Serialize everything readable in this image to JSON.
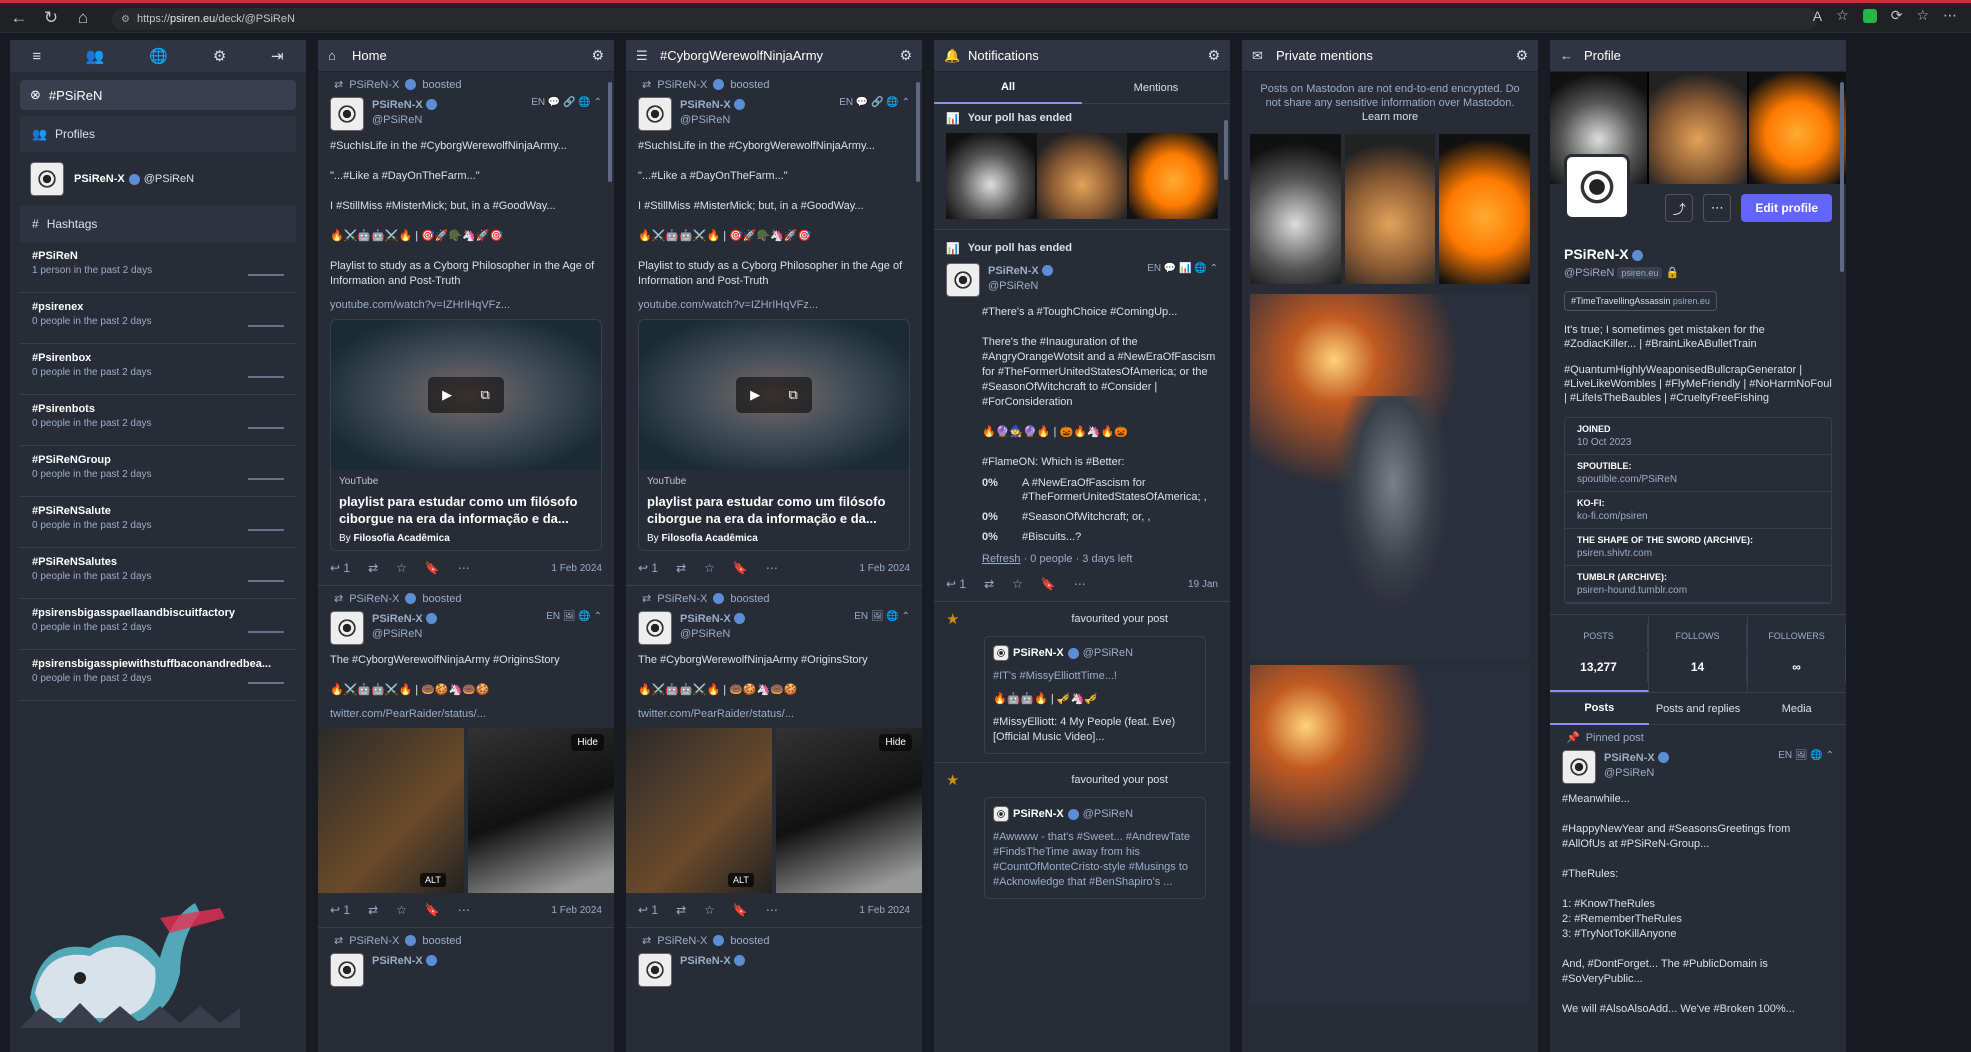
{
  "browser": {
    "url_scheme": "https://",
    "url_host": "psiren.eu",
    "url_path": "/deck/@PSiReN"
  },
  "left": {
    "active_tag": "#PSiReN",
    "profiles_label": "Profiles",
    "profile_name": "PSiReN-X",
    "profile_handle": "@PSiReN",
    "hashtags_label": "Hashtags",
    "tags": [
      {
        "name": "#PSiReN",
        "stat": "1 person in the past 2 days"
      },
      {
        "name": "#psirenex",
        "stat": "0 people in the past 2 days"
      },
      {
        "name": "#Psirenbox",
        "stat": "0 people in the past 2 days"
      },
      {
        "name": "#Psirenbots",
        "stat": "0 people in the past 2 days"
      },
      {
        "name": "#PSiReNGroup",
        "stat": "0 people in the past 2 days"
      },
      {
        "name": "#PSiReNSalute",
        "stat": "0 people in the past 2 days"
      },
      {
        "name": "#PSiReNSalutes",
        "stat": "0 people in the past 2 days"
      },
      {
        "name": "#psirensbigasspaellaandbiscuitfactory",
        "stat": "0 people in the past 2 days"
      },
      {
        "name": "#psirensbigasspiewithstuffbaconandredbea...",
        "stat": "0 people in the past 2 days"
      }
    ]
  },
  "home": {
    "title": "Home",
    "boosted_by": "PSiReN-X",
    "boosted": "boosted",
    "author": "PSiReN-X",
    "handle": "@PSiReN",
    "lang": "EN",
    "p1_l1": "#SuchIsLife in the #CyborgWerewolfNinjaArmy...",
    "p1_l2": "\"...#Like a #DayOnTheFarm...\"",
    "p1_l3": "I #StillMiss #MisterMick; but, in a #GoodWay...",
    "p1_emoji": "🔥⚔️🤖🤖⚔️🔥 | 🎯🚀🪖🦄🚀🎯",
    "p1_l4": "Playlist to study as a Cyborg Philosopher in the Age of Information and Post-Truth",
    "p1_link": "youtube.com/watch?v=IZHrIHqVFz...",
    "card_provider": "YouTube",
    "card_title": "playlist para estudar como um filósofo ciborgue na era da informação e da...",
    "card_by_prefix": "By ",
    "card_by": "Filosofia Acadêmica",
    "reply_count": "1",
    "date": "1 Feb 2024",
    "p2_l1": "The #CyborgWerewolfNinjaArmy #OriginsStory",
    "p2_emoji": "🔥⚔️🤖🤖⚔️🔥 | 🍩🍪🦄🍩🍪",
    "p2_link": "twitter.com/PearRaider/status/...",
    "hide": "Hide",
    "alt": "ALT"
  },
  "cwna": {
    "title": "#CyborgWerewolfNinjaArmy"
  },
  "notifications": {
    "title": "Notifications",
    "tab_all": "All",
    "tab_mentions": "Mentions",
    "poll_ended": "Your poll has ended",
    "p_l1": "#There's a #ToughChoice #ComingUp...",
    "p_l2": "There's the #Inauguration of the #AngryOrangeWotsit and a #NewEraOfFascism for #TheFormerUnitedStatesOfAmerica; or the #SeasonOfWitchcraft to #Consider | #ForConsideration",
    "p_emoji": "🔥🔮🧙🔮🔥 | 🎃🔥🦄🔥🎃",
    "p_l3": "#FlameON: Which is #Better:",
    "opts": [
      {
        "pct": "0%",
        "txt": "A #NewEraOfFascism for #TheFormerUnitedStatesOfAmerica; ,"
      },
      {
        "pct": "0%",
        "txt": "#SeasonOfWitchcraft; or, ,"
      },
      {
        "pct": "0%",
        "txt": "#Biscuits...?"
      }
    ],
    "refresh": "Refresh",
    "poll_meta": " · 0 people · 3 days left",
    "poll_date": "19 Jan",
    "fav": "favourited your post",
    "n1_text": "#IT's #MissyElliottTime...!",
    "n1_emoji": "🔥🤖🤖🔥 | 🎺🦄🎺",
    "n1_link": "#MissyElliott: 4 My People (feat. Eve) [Official Music Video]...",
    "n2_text": "#Awwww - that's #Sweet... #AndrewTate #FindsTheTime away from his #CountOfMonteCristo-style #Musings to #Acknowledge that #BenShapiro's ..."
  },
  "pm": {
    "title": "Private mentions",
    "note": "Posts on Mastodon are not end-to-end encrypted. Do not share any sensitive information over Mastodon.",
    "learn": "Learn more"
  },
  "profile": {
    "title": "Profile",
    "name": "PSiReN-X",
    "handle": "@PSiReN",
    "domain": "psiren.eu",
    "edit": "Edit profile",
    "featured": "#TimeTravellingAssassin",
    "featured_domain": "psiren.eu",
    "bio1": "It's true; I sometimes get mistaken for the #ZodiacKiller... | #BrainLikeABulletTrain",
    "bio2": "#QuantumHighlyWeaponisedBullcrapGenerator | #LiveLikeWombles | #FlyMeFriendly | #NoHarmNoFoul | #LifeIsTheBaubles | #CrueltyFreeFishing",
    "fields": [
      {
        "k": "JOINED",
        "v": "10 Oct 2023"
      },
      {
        "k": "SPOUTIBLE:",
        "v": "spoutible.com/PSiReN"
      },
      {
        "k": "KO-FI:",
        "v": "ko-fi.com/psiren"
      },
      {
        "k": "THE SHAPE OF THE SWORD (ARCHIVE):",
        "v": "psiren.shivtr.com"
      },
      {
        "k": "TUMBLR (ARCHIVE):",
        "v": "psiren-hound.tumblr.com"
      }
    ],
    "posts_k": "POSTS",
    "posts_v": "13,277",
    "follows_k": "FOLLOWS",
    "follows_v": "14",
    "followers_k": "FOLLOWERS",
    "followers_v": "∞",
    "tab_posts": "Posts",
    "tab_replies": "Posts and replies",
    "tab_media": "Media",
    "pinned": "Pinned post",
    "pin_l1": "#Meanwhile...",
    "pin_l2": "#HappyNewYear and #SeasonsGreetings from #AllOfUs at #PSiReN-Group...",
    "pin_l3": "#TheRules:",
    "pin_l4": "1: #KnowTheRules",
    "pin_l5": "2: #RememberTheRules",
    "pin_l6": "3: #TryNotToKillAnyone",
    "pin_l7": "And, #DontForget... The #PublicDomain is #SoVeryPublic...",
    "pin_l8": "We will #AlsoAlsoAdd... We've #Broken 100%..."
  }
}
